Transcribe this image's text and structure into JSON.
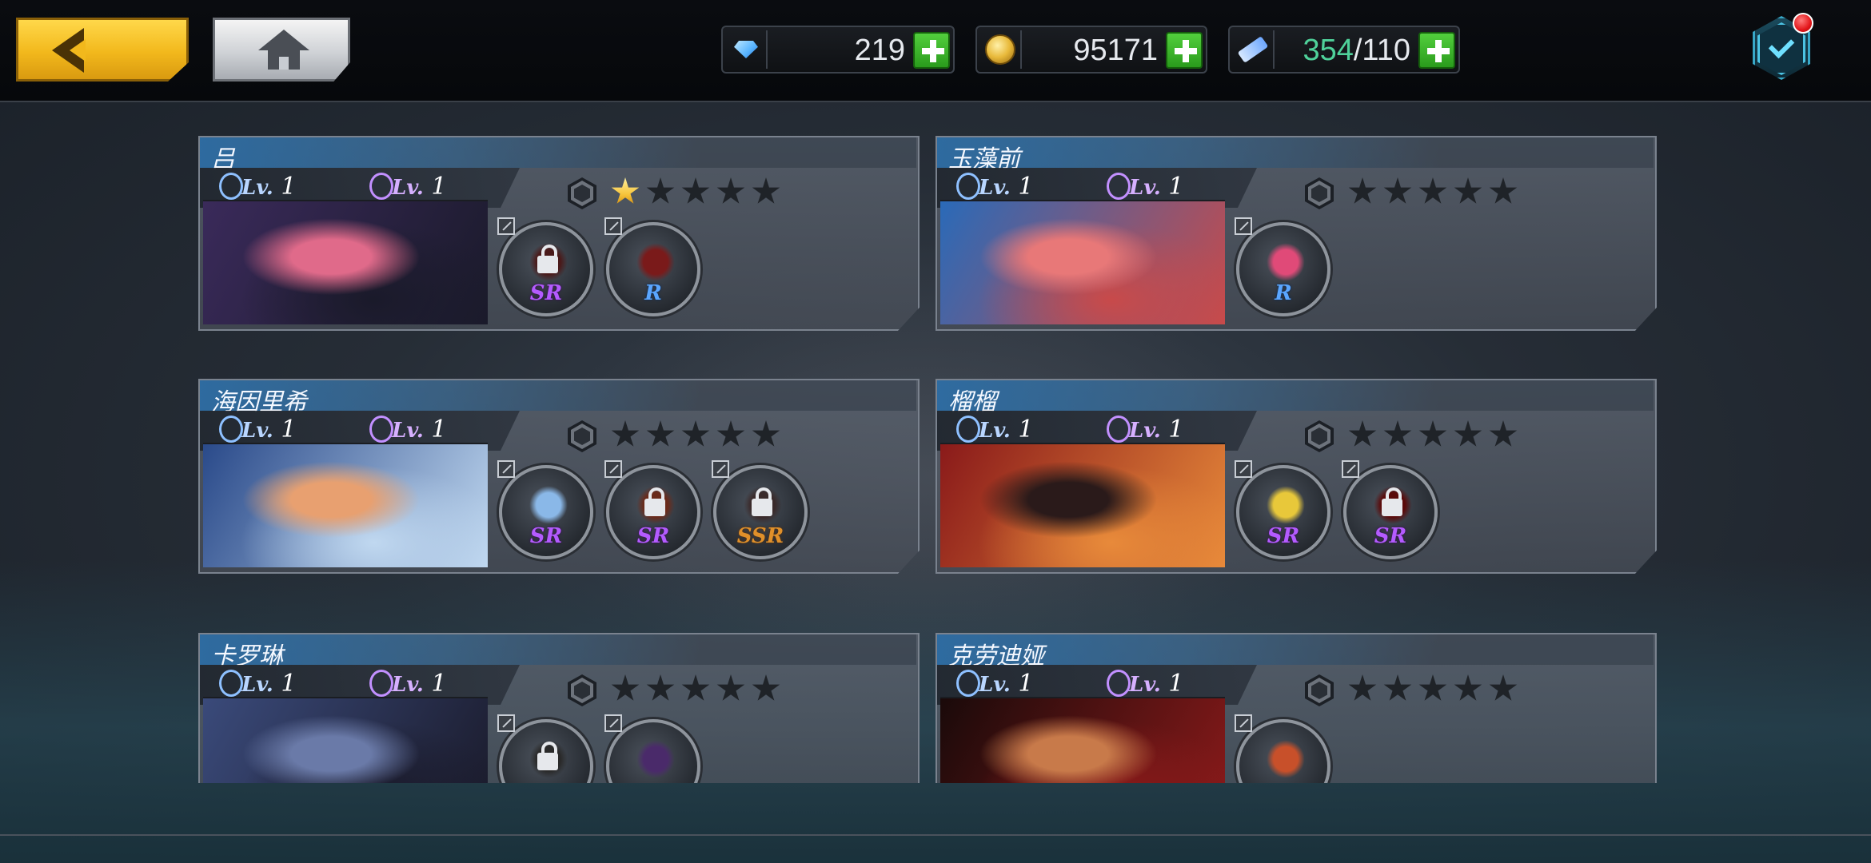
{
  "topbar": {
    "back_label": "",
    "home_label": "",
    "resources": [
      {
        "name": "diamond",
        "icon": "gem-icon",
        "value": "219",
        "value_highlight": "",
        "value_rest": "219"
      },
      {
        "name": "gold",
        "icon": "coin-icon",
        "value": "95171",
        "value_highlight": "",
        "value_rest": "95171"
      },
      {
        "name": "stamina",
        "icon": "ticket-icon",
        "value": "354/110",
        "value_highlight": "354",
        "value_rest": "/110"
      }
    ],
    "mail_has_notification": true
  },
  "level_prefix": "Lv.",
  "cards": [
    {
      "name": "吕",
      "hero_level": "1",
      "weapon_level": "1",
      "stars_on": 1,
      "stars_total": 5,
      "portrait_colors": [
        "#3a2a5a",
        "#e06a8a",
        "#1a1a2a"
      ],
      "equips": [
        {
          "rarity": "SR",
          "locked": true,
          "color": "#4a1a1a"
        },
        {
          "rarity": "R",
          "locked": false,
          "color": "#7a1a1a"
        }
      ]
    },
    {
      "name": "玉藻前",
      "hero_level": "1",
      "weapon_level": "1",
      "stars_on": 0,
      "stars_total": 5,
      "portrait_colors": [
        "#2a6ab8",
        "#e87878",
        "#c84a4a"
      ],
      "equips": [
        {
          "rarity": "R",
          "locked": false,
          "color": "#e04a78"
        }
      ]
    },
    {
      "name": "海因里希",
      "hero_level": "1",
      "weapon_level": "1",
      "stars_on": 0,
      "stars_total": 5,
      "portrait_colors": [
        "#2a4a8a",
        "#e8a070",
        "#c0d8f0"
      ],
      "equips": [
        {
          "rarity": "SR",
          "locked": false,
          "color": "#8ab8e8"
        },
        {
          "rarity": "SR",
          "locked": true,
          "color": "#6a2a1a"
        },
        {
          "rarity": "SSR",
          "locked": true,
          "color": "#3a2a2a"
        }
      ]
    },
    {
      "name": "榴榴",
      "hero_level": "1",
      "weapon_level": "1",
      "stars_on": 0,
      "stars_total": 5,
      "portrait_colors": [
        "#8a1a1a",
        "#2a1a1a",
        "#e88a3a"
      ],
      "equips": [
        {
          "rarity": "SR",
          "locked": false,
          "color": "#e8c83a"
        },
        {
          "rarity": "SR",
          "locked": true,
          "color": "#5a0a0a"
        }
      ]
    },
    {
      "name": "卡罗琳",
      "hero_level": "1",
      "weapon_level": "1",
      "stars_on": 0,
      "stars_total": 5,
      "portrait_colors": [
        "#3a4a7a",
        "#6a7aa8",
        "#1a1a2a"
      ],
      "equips": [
        {
          "rarity": "",
          "locked": true,
          "color": "#2a2a2a"
        },
        {
          "rarity": "",
          "locked": false,
          "color": "#4a2a6a"
        }
      ]
    },
    {
      "name": "克劳迪娅",
      "hero_level": "1",
      "weapon_level": "1",
      "stars_on": 0,
      "stars_total": 5,
      "portrait_colors": [
        "#1a0a0a",
        "#c87a4a",
        "#8a1a1a"
      ],
      "equips": [
        {
          "rarity": "",
          "locked": false,
          "color": "#c8502a"
        }
      ]
    }
  ],
  "colors": {
    "accent_gold": "#f2b81c",
    "plus_green": "#2a9b1c",
    "highlight_green": "#4fd19a",
    "rarity_SR": "#b45bff",
    "rarity_R": "#5aa6ff",
    "rarity_SSR": "#e0902a"
  }
}
